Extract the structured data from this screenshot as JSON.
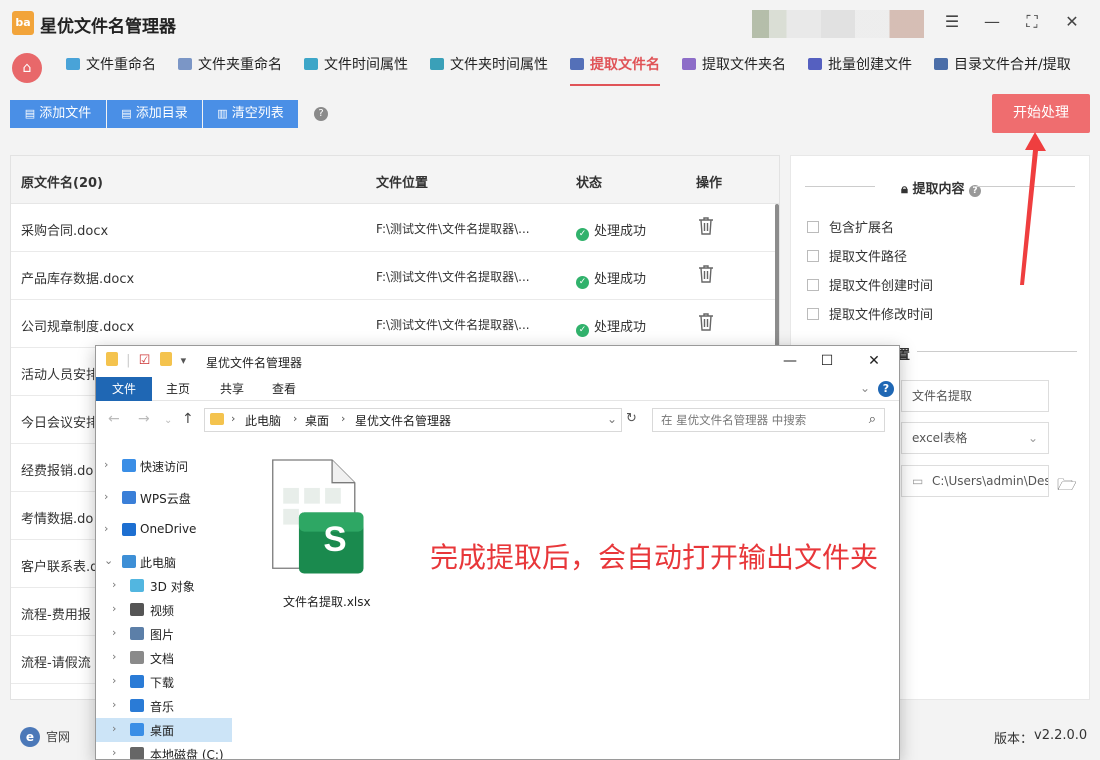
{
  "app": {
    "title": "星优文件名管理器",
    "logo_text": "ba"
  },
  "tabs": [
    {
      "label": "文件重命名",
      "color": "#49a3d8"
    },
    {
      "label": "文件夹重命名",
      "color": "#7b96c6"
    },
    {
      "label": "文件时间属性",
      "color": "#3da6c8"
    },
    {
      "label": "文件夹时间属性",
      "color": "#3aa0b8"
    },
    {
      "label": "提取文件名",
      "color": "#5470b8",
      "active": true
    },
    {
      "label": "提取文件夹名",
      "color": "#8d6dc8"
    },
    {
      "label": "批量创建文件",
      "color": "#5560c0"
    },
    {
      "label": "目录文件合并/提取",
      "color": "#4b6ea8"
    }
  ],
  "toolbar": {
    "add_file": "添加文件",
    "add_dir": "添加目录",
    "clear_list": "清空列表",
    "start": "开始处理"
  },
  "table": {
    "headers": {
      "name": "原文件名(20)",
      "path": "文件位置",
      "status": "状态",
      "op": "操作"
    },
    "rows": [
      {
        "name": "采购合同.docx",
        "path": "F:\\测试文件\\文件名提取器\\...",
        "status": "处理成功"
      },
      {
        "name": "产品库存数据.docx",
        "path": "F:\\测试文件\\文件名提取器\\...",
        "status": "处理成功"
      },
      {
        "name": "公司规章制度.docx",
        "path": "F:\\测试文件\\文件名提取器\\...",
        "status": "处理成功"
      },
      {
        "name": "活动人员安排"
      },
      {
        "name": "今日会议安排"
      },
      {
        "name": "经费报销.do"
      },
      {
        "name": "考情数据.do"
      },
      {
        "name": "客户联系表.d"
      },
      {
        "name": "流程-费用报"
      },
      {
        "name": "流程-请假流"
      }
    ]
  },
  "settings": {
    "section_title": "提取内容",
    "options": [
      "包含扩展名",
      "提取文件路径",
      "提取文件创建时间",
      "提取文件修改时间"
    ],
    "section2_title_partial": "置",
    "filename_value": "文件名提取",
    "format_value": "excel表格",
    "output_path": "C:\\Users\\admin\\Des"
  },
  "statusbar": {
    "site_label": "官网",
    "version_label": "版本：",
    "version_value": "v2.2.0.0"
  },
  "explorer": {
    "title": "星优文件名管理器",
    "ribbon": [
      "文件",
      "主页",
      "共享",
      "查看"
    ],
    "breadcrumb": [
      "此电脑",
      "桌面",
      "星优文件名管理器"
    ],
    "search_placeholder": "在 星优文件名管理器 中搜索",
    "nav_items": [
      {
        "label": "快速访问",
        "icon": "star-icon",
        "color": "#3a8ee6",
        "indent": 0
      },
      {
        "label": "WPS云盘",
        "icon": "cloud-icon",
        "color": "#3a7fd8",
        "indent": 0
      },
      {
        "label": "OneDrive",
        "icon": "onedrive-icon",
        "color": "#1d6fd1",
        "indent": 0
      },
      {
        "label": "此电脑",
        "icon": "computer-icon",
        "color": "#3d8fd6",
        "indent": 0
      },
      {
        "label": "3D 对象",
        "icon": "cube-icon",
        "color": "#52b6e0",
        "indent": 1
      },
      {
        "label": "视频",
        "icon": "video-icon",
        "color": "#555555",
        "indent": 1
      },
      {
        "label": "图片",
        "icon": "picture-icon",
        "color": "#5c7fa8",
        "indent": 1
      },
      {
        "label": "文档",
        "icon": "document-icon",
        "color": "#8a8a8a",
        "indent": 1
      },
      {
        "label": "下载",
        "icon": "download-icon",
        "color": "#2a7bd6",
        "indent": 1
      },
      {
        "label": "音乐",
        "icon": "music-icon",
        "color": "#2a7bd6",
        "indent": 1
      },
      {
        "label": "桌面",
        "icon": "desktop-icon",
        "color": "#3a8ee6",
        "indent": 1,
        "selected": true
      },
      {
        "label": "本地磁盘 (C:)",
        "icon": "disk-icon",
        "color": "#666666",
        "indent": 1
      }
    ],
    "file_name": "文件名提取.xlsx",
    "file_badge": "S"
  },
  "callout": "完成提取后，会自动打开输出文件夹",
  "colors": {
    "accent_red": "#e05357",
    "button_blue": "#4a8fe6",
    "start_red": "#ef6d6f",
    "success_green": "#31b26c"
  }
}
